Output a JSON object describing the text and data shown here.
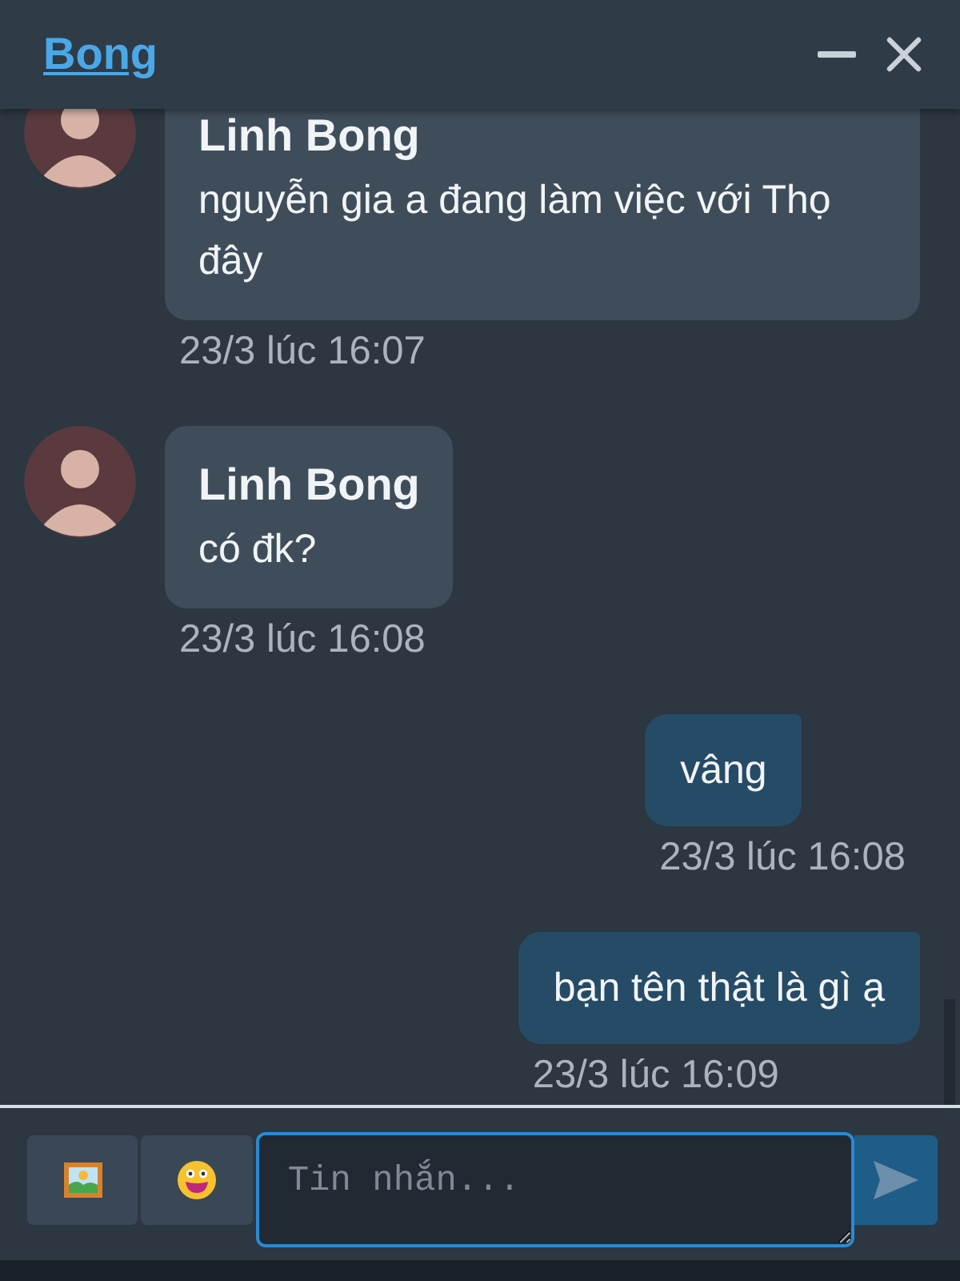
{
  "header": {
    "title": "Bong"
  },
  "messages": [
    {
      "kind": "incoming",
      "sender": "Linh Bong",
      "text": "nguyễn gia a đang làm việc với Thọ đây",
      "time": "23/3 lúc 16:07"
    },
    {
      "kind": "incoming",
      "sender": "Linh Bong",
      "text": "có đk?",
      "time": "23/3 lúc 16:08"
    },
    {
      "kind": "outgoing",
      "text": "vâng",
      "time": "23/3 lúc 16:08"
    },
    {
      "kind": "outgoing",
      "text": "bạn tên thật là gì ạ",
      "time": "23/3 lúc 16:09"
    }
  ],
  "composer": {
    "placeholder": "Tin nhắn..."
  }
}
